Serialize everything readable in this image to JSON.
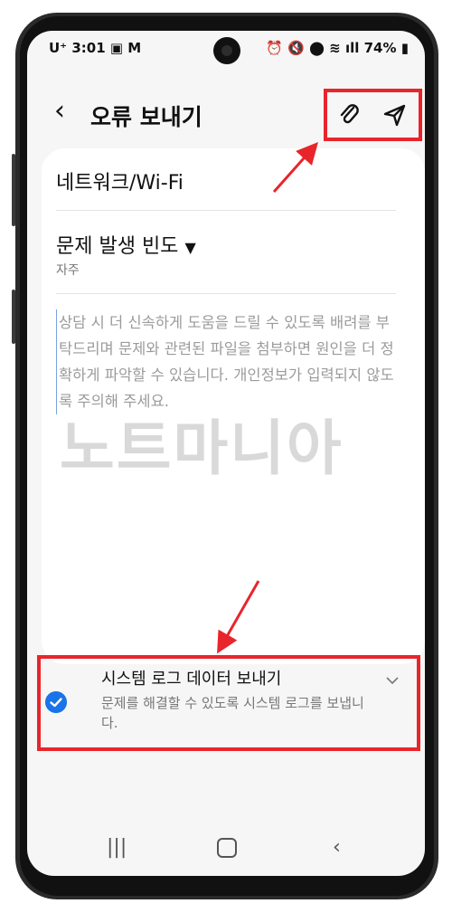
{
  "status_bar": {
    "carrier": "U⁺",
    "time": "3:01",
    "battery": "74%"
  },
  "app_bar": {
    "title": "오류 보내기"
  },
  "form": {
    "category": "네트워크/Wi-Fi",
    "frequency_label": "문제 발생 빈도",
    "frequency_value": "자주",
    "placeholder": "상담 시 더 신속하게 도움을 드릴 수 있도록 배려를 부탁드리며 문제와 관련된 파일을 첨부하면 원인을 더 정확하게 파악할 수 있습니다. 개인정보가 입력되지 않도록 주의해 주세요."
  },
  "watermark": "노트마니아",
  "system_log": {
    "title": "시스템 로그 데이터 보내기",
    "description": "문제를 해결할 수 있도록 시스템 로그를 보냅니다.",
    "checked": true
  },
  "colors": {
    "accent": "#1a73e8",
    "highlight": "#e8252b"
  },
  "icons": {
    "attach": "paperclip-icon",
    "send": "send-icon"
  }
}
